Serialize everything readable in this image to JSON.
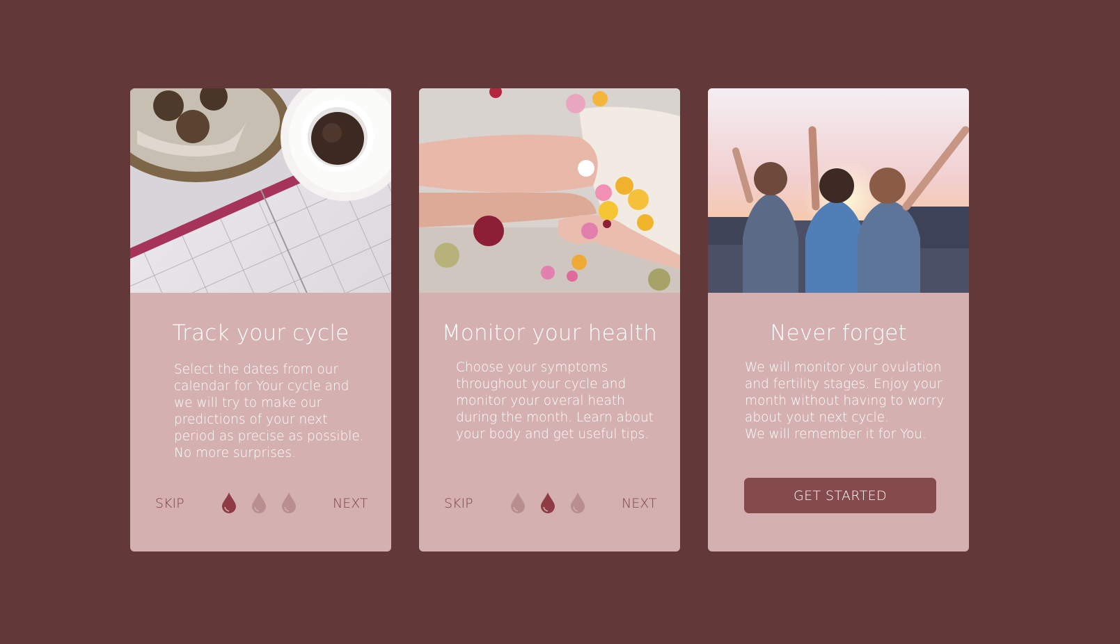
{
  "colors": {
    "background": "#633839",
    "card": "#d5b0b0",
    "accent": "#844a4c",
    "nav_text": "#7d4547",
    "drop_active": "#8e3b45",
    "drop_inactive": "#b88e8f"
  },
  "cards": [
    {
      "image": "calendar-coffee-photo",
      "title": "Track your cycle",
      "body": [
        "Select the dates from our",
        "calendar for Your cycle and",
        "we will try to make our",
        "predictions of your next",
        "period as precise as possible.",
        "No more surprises."
      ],
      "skip_label": "SKIP",
      "next_label": "NEXT",
      "active_dot": 0
    },
    {
      "image": "flowers-bath-photo",
      "title": "Monitor your health",
      "body": [
        "Choose your symptoms",
        "throughout your cycle and",
        "monitor your overal heath",
        "during the month. Learn about",
        "your body and get useful tips."
      ],
      "skip_label": "SKIP",
      "next_label": "NEXT",
      "active_dot": 1
    },
    {
      "image": "friends-sunset-photo",
      "title": "Never forget",
      "body": [
        "We will monitor your ovulation",
        "and fertility stages. Enjoy your",
        "month without having to worry",
        "about yout next cycle.",
        "We will remember it for You."
      ],
      "button_label": "GET STARTED"
    }
  ]
}
